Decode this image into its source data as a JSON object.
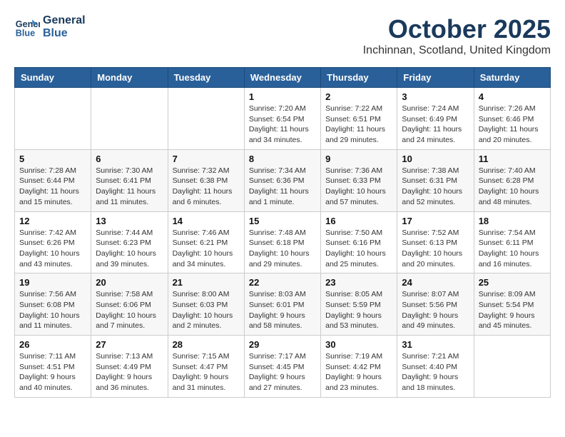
{
  "header": {
    "logo_line1": "General",
    "logo_line2": "Blue",
    "title": "October 2025",
    "subtitle": "Inchinnan, Scotland, United Kingdom"
  },
  "days_of_week": [
    "Sunday",
    "Monday",
    "Tuesday",
    "Wednesday",
    "Thursday",
    "Friday",
    "Saturday"
  ],
  "weeks": [
    [
      {
        "day": "",
        "info": ""
      },
      {
        "day": "",
        "info": ""
      },
      {
        "day": "",
        "info": ""
      },
      {
        "day": "1",
        "info": "Sunrise: 7:20 AM\nSunset: 6:54 PM\nDaylight: 11 hours\nand 34 minutes."
      },
      {
        "day": "2",
        "info": "Sunrise: 7:22 AM\nSunset: 6:51 PM\nDaylight: 11 hours\nand 29 minutes."
      },
      {
        "day": "3",
        "info": "Sunrise: 7:24 AM\nSunset: 6:49 PM\nDaylight: 11 hours\nand 24 minutes."
      },
      {
        "day": "4",
        "info": "Sunrise: 7:26 AM\nSunset: 6:46 PM\nDaylight: 11 hours\nand 20 minutes."
      }
    ],
    [
      {
        "day": "5",
        "info": "Sunrise: 7:28 AM\nSunset: 6:44 PM\nDaylight: 11 hours\nand 15 minutes."
      },
      {
        "day": "6",
        "info": "Sunrise: 7:30 AM\nSunset: 6:41 PM\nDaylight: 11 hours\nand 11 minutes."
      },
      {
        "day": "7",
        "info": "Sunrise: 7:32 AM\nSunset: 6:38 PM\nDaylight: 11 hours\nand 6 minutes."
      },
      {
        "day": "8",
        "info": "Sunrise: 7:34 AM\nSunset: 6:36 PM\nDaylight: 11 hours\nand 1 minute."
      },
      {
        "day": "9",
        "info": "Sunrise: 7:36 AM\nSunset: 6:33 PM\nDaylight: 10 hours\nand 57 minutes."
      },
      {
        "day": "10",
        "info": "Sunrise: 7:38 AM\nSunset: 6:31 PM\nDaylight: 10 hours\nand 52 minutes."
      },
      {
        "day": "11",
        "info": "Sunrise: 7:40 AM\nSunset: 6:28 PM\nDaylight: 10 hours\nand 48 minutes."
      }
    ],
    [
      {
        "day": "12",
        "info": "Sunrise: 7:42 AM\nSunset: 6:26 PM\nDaylight: 10 hours\nand 43 minutes."
      },
      {
        "day": "13",
        "info": "Sunrise: 7:44 AM\nSunset: 6:23 PM\nDaylight: 10 hours\nand 39 minutes."
      },
      {
        "day": "14",
        "info": "Sunrise: 7:46 AM\nSunset: 6:21 PM\nDaylight: 10 hours\nand 34 minutes."
      },
      {
        "day": "15",
        "info": "Sunrise: 7:48 AM\nSunset: 6:18 PM\nDaylight: 10 hours\nand 29 minutes."
      },
      {
        "day": "16",
        "info": "Sunrise: 7:50 AM\nSunset: 6:16 PM\nDaylight: 10 hours\nand 25 minutes."
      },
      {
        "day": "17",
        "info": "Sunrise: 7:52 AM\nSunset: 6:13 PM\nDaylight: 10 hours\nand 20 minutes."
      },
      {
        "day": "18",
        "info": "Sunrise: 7:54 AM\nSunset: 6:11 PM\nDaylight: 10 hours\nand 16 minutes."
      }
    ],
    [
      {
        "day": "19",
        "info": "Sunrise: 7:56 AM\nSunset: 6:08 PM\nDaylight: 10 hours\nand 11 minutes."
      },
      {
        "day": "20",
        "info": "Sunrise: 7:58 AM\nSunset: 6:06 PM\nDaylight: 10 hours\nand 7 minutes."
      },
      {
        "day": "21",
        "info": "Sunrise: 8:00 AM\nSunset: 6:03 PM\nDaylight: 10 hours\nand 2 minutes."
      },
      {
        "day": "22",
        "info": "Sunrise: 8:03 AM\nSunset: 6:01 PM\nDaylight: 9 hours\nand 58 minutes."
      },
      {
        "day": "23",
        "info": "Sunrise: 8:05 AM\nSunset: 5:59 PM\nDaylight: 9 hours\nand 53 minutes."
      },
      {
        "day": "24",
        "info": "Sunrise: 8:07 AM\nSunset: 5:56 PM\nDaylight: 9 hours\nand 49 minutes."
      },
      {
        "day": "25",
        "info": "Sunrise: 8:09 AM\nSunset: 5:54 PM\nDaylight: 9 hours\nand 45 minutes."
      }
    ],
    [
      {
        "day": "26",
        "info": "Sunrise: 7:11 AM\nSunset: 4:51 PM\nDaylight: 9 hours\nand 40 minutes."
      },
      {
        "day": "27",
        "info": "Sunrise: 7:13 AM\nSunset: 4:49 PM\nDaylight: 9 hours\nand 36 minutes."
      },
      {
        "day": "28",
        "info": "Sunrise: 7:15 AM\nSunset: 4:47 PM\nDaylight: 9 hours\nand 31 minutes."
      },
      {
        "day": "29",
        "info": "Sunrise: 7:17 AM\nSunset: 4:45 PM\nDaylight: 9 hours\nand 27 minutes."
      },
      {
        "day": "30",
        "info": "Sunrise: 7:19 AM\nSunset: 4:42 PM\nDaylight: 9 hours\nand 23 minutes."
      },
      {
        "day": "31",
        "info": "Sunrise: 7:21 AM\nSunset: 4:40 PM\nDaylight: 9 hours\nand 18 minutes."
      },
      {
        "day": "",
        "info": ""
      }
    ]
  ]
}
